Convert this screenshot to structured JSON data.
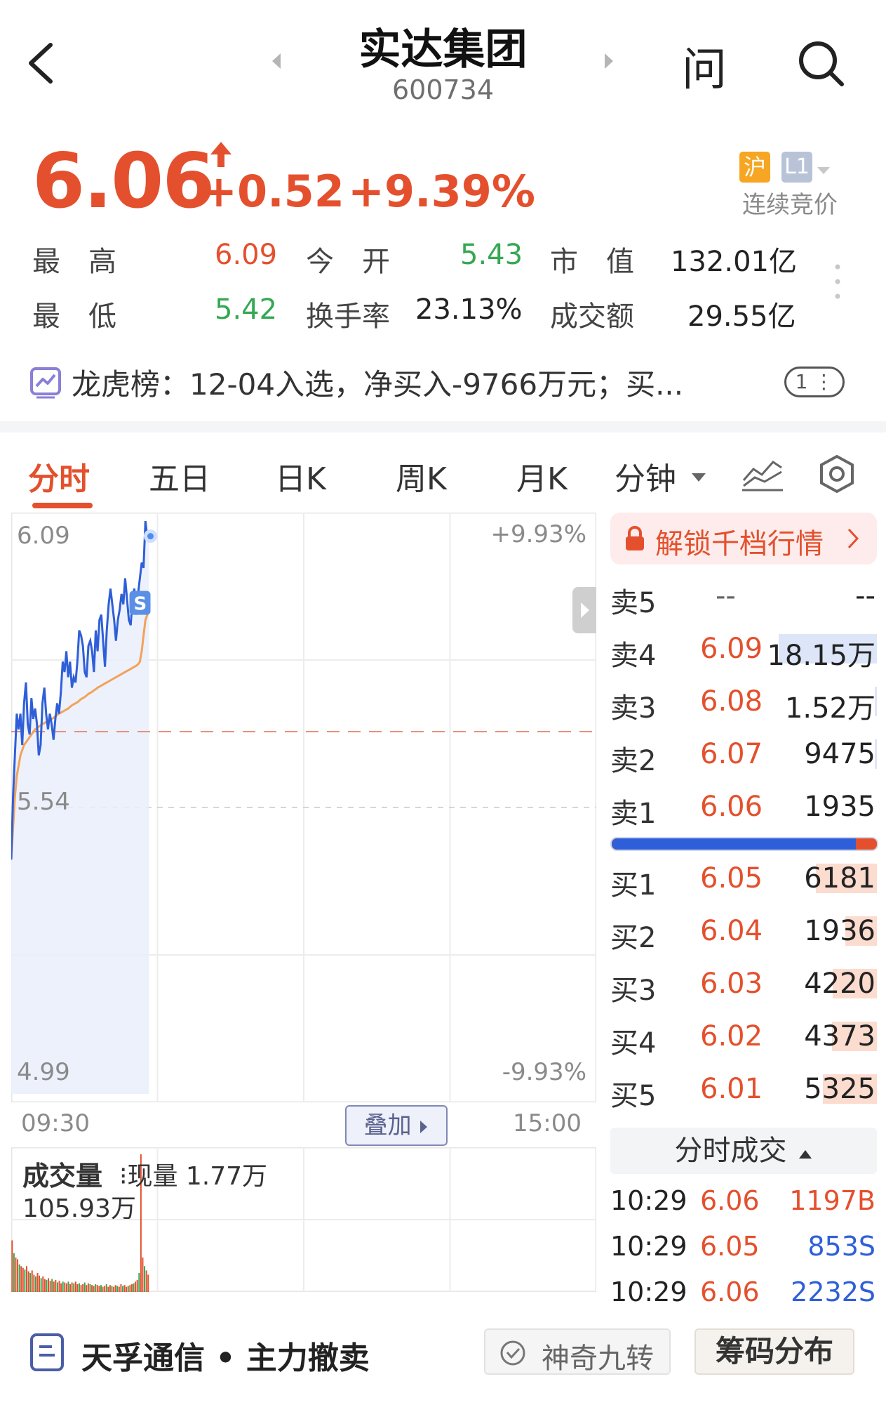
{
  "header": {
    "back_icon": "chevron-left-icon",
    "title": "实达集团",
    "code": "600734",
    "ask_label": "问",
    "search_icon": "search-icon"
  },
  "quote": {
    "price": "6.06",
    "change": "+0.52",
    "change_pct": "+9.39%",
    "market_badge": "沪",
    "level_badge": "L1",
    "auction_text": "连续竞价",
    "stats": [
      {
        "label": "最　高",
        "value": "6.09",
        "color": "#e4502d"
      },
      {
        "label": "今　开",
        "value": "5.43",
        "color": "#34a853"
      },
      {
        "label": "市　值",
        "value": "132.01亿",
        "color": "#222222"
      },
      {
        "label": "最　低",
        "value": "5.42",
        "color": "#34a853"
      },
      {
        "label": "换手率",
        "value": "23.13%",
        "color": "#222222"
      },
      {
        "label": "成交额",
        "value": "29.55亿",
        "color": "#222222"
      }
    ]
  },
  "notice": {
    "text": "龙虎榜：12-04入选，净买入-9766万元；买...",
    "counter": "1"
  },
  "tabs": [
    {
      "label": "分时",
      "active": true
    },
    {
      "label": "五日",
      "active": false
    },
    {
      "label": "日K",
      "active": false
    },
    {
      "label": "周K",
      "active": false
    },
    {
      "label": "月K",
      "active": false
    },
    {
      "label": "分钟",
      "active": false
    }
  ],
  "chart_data": {
    "type": "line",
    "y_left_labels": [
      "6.09",
      "5.54",
      "4.99"
    ],
    "y_right_labels": [
      "+9.93%",
      "-9.93%"
    ],
    "x_labels": [
      "09:30",
      "15:00"
    ],
    "ylim": [
      4.99,
      6.09
    ],
    "prev_close": 5.54,
    "series": [
      {
        "values": [
          5.44,
          5.56,
          5.64,
          5.72,
          5.69,
          5.72,
          5.66,
          5.74,
          5.78,
          5.7,
          5.68,
          5.75,
          5.71,
          5.73,
          5.7,
          5.64,
          5.66,
          5.74,
          5.77,
          5.72,
          5.69,
          5.72,
          5.7,
          5.67,
          5.71,
          5.74,
          5.72,
          5.76,
          5.82,
          5.8,
          5.84,
          5.79,
          5.82,
          5.77,
          5.79,
          5.78,
          5.82,
          5.88,
          5.87,
          5.85,
          5.8,
          5.79,
          5.85,
          5.86,
          5.84,
          5.8,
          5.88,
          5.84,
          5.9,
          5.91,
          5.86,
          5.81,
          5.88,
          5.93,
          5.96,
          5.93,
          5.9,
          5.86,
          5.9,
          5.92,
          5.95,
          5.93,
          5.98,
          5.94,
          5.9,
          5.89,
          5.94,
          5.96,
          5.91,
          5.95,
          5.98,
          6.01,
          6.0,
          6.09,
          6.06,
          6.05
        ]
      },
      {
        "values": [
          5.44,
          5.5,
          5.56,
          5.6,
          5.62,
          5.64,
          5.65,
          5.66,
          5.665,
          5.67,
          5.675,
          5.68,
          5.685,
          5.69,
          5.692,
          5.695,
          5.698,
          5.7,
          5.702,
          5.704,
          5.706,
          5.708,
          5.71,
          5.712,
          5.715,
          5.718,
          5.72,
          5.722,
          5.724,
          5.726,
          5.728,
          5.73,
          5.733,
          5.736,
          5.738,
          5.74,
          5.742,
          5.745,
          5.748,
          5.75,
          5.752,
          5.755,
          5.758,
          5.76,
          5.762,
          5.765,
          5.767,
          5.77,
          5.772,
          5.774,
          5.776,
          5.778,
          5.78,
          5.782,
          5.784,
          5.786,
          5.788,
          5.79,
          5.792,
          5.794,
          5.796,
          5.798,
          5.8,
          5.802,
          5.804,
          5.806,
          5.808,
          5.81,
          5.812,
          5.815,
          5.82,
          5.84,
          5.87,
          5.9,
          5.91,
          5.92
        ]
      }
    ],
    "volume_label": "成交量",
    "volume_now": "现量 1.77万",
    "volume_max": "105.93万",
    "volume_values": [
      60,
      45,
      40,
      38,
      32,
      30,
      28,
      26,
      30,
      24,
      22,
      25,
      20,
      18,
      22,
      19,
      16,
      18,
      15,
      14,
      16,
      13,
      15,
      12,
      14,
      11,
      13,
      10,
      12,
      11,
      10,
      12,
      9,
      11,
      10,
      12,
      9,
      10,
      8,
      9,
      11,
      8,
      10,
      9,
      8,
      7,
      9,
      8,
      7,
      8,
      6,
      7,
      9,
      6,
      8,
      7,
      6,
      8,
      7,
      6,
      9,
      7,
      8,
      6,
      7,
      8,
      9,
      10,
      12,
      14,
      22,
      160,
      40,
      30,
      25,
      20
    ]
  },
  "overlay_button": "叠加",
  "order_book": {
    "unlock_text": "解锁千档行情",
    "asks": [
      {
        "label": "卖5",
        "price": "--",
        "volume": "--",
        "bar": 0
      },
      {
        "label": "卖4",
        "price": "6.09",
        "volume": "18.15万",
        "bar": 1.0
      },
      {
        "label": "卖3",
        "price": "6.08",
        "volume": "1.52万",
        "bar": 0.02
      },
      {
        "label": "卖2",
        "price": "6.07",
        "volume": "9475",
        "bar": 0.02
      },
      {
        "label": "卖1",
        "price": "6.06",
        "volume": "1935",
        "bar": 0
      }
    ],
    "bid_ratio": 0.92,
    "bids": [
      {
        "label": "买1",
        "price": "6.05",
        "volume": "6181",
        "bar": 0.62
      },
      {
        "label": "买2",
        "price": "6.04",
        "volume": "1936",
        "bar": 0.32
      },
      {
        "label": "买3",
        "price": "6.03",
        "volume": "4220",
        "bar": 0.45
      },
      {
        "label": "买4",
        "price": "6.02",
        "volume": "4373",
        "bar": 0.46
      },
      {
        "label": "买5",
        "price": "6.01",
        "volume": "5325",
        "bar": 0.55
      }
    ],
    "ticks_title": "分时成交",
    "ticks": [
      {
        "time": "10:29",
        "price": "6.06",
        "volume": "1197B",
        "color": "#e4502d"
      },
      {
        "time": "10:29",
        "price": "6.05",
        "volume": "853S",
        "color": "#2f5fd8"
      },
      {
        "time": "10:29",
        "price": "6.06",
        "volume": "2232S",
        "color": "#2f5fd8"
      }
    ]
  },
  "bottom_bar": {
    "news_text": "天孚通信 • 主力撤卖",
    "btn1": "神奇九转",
    "btn2": "筹码分布"
  }
}
